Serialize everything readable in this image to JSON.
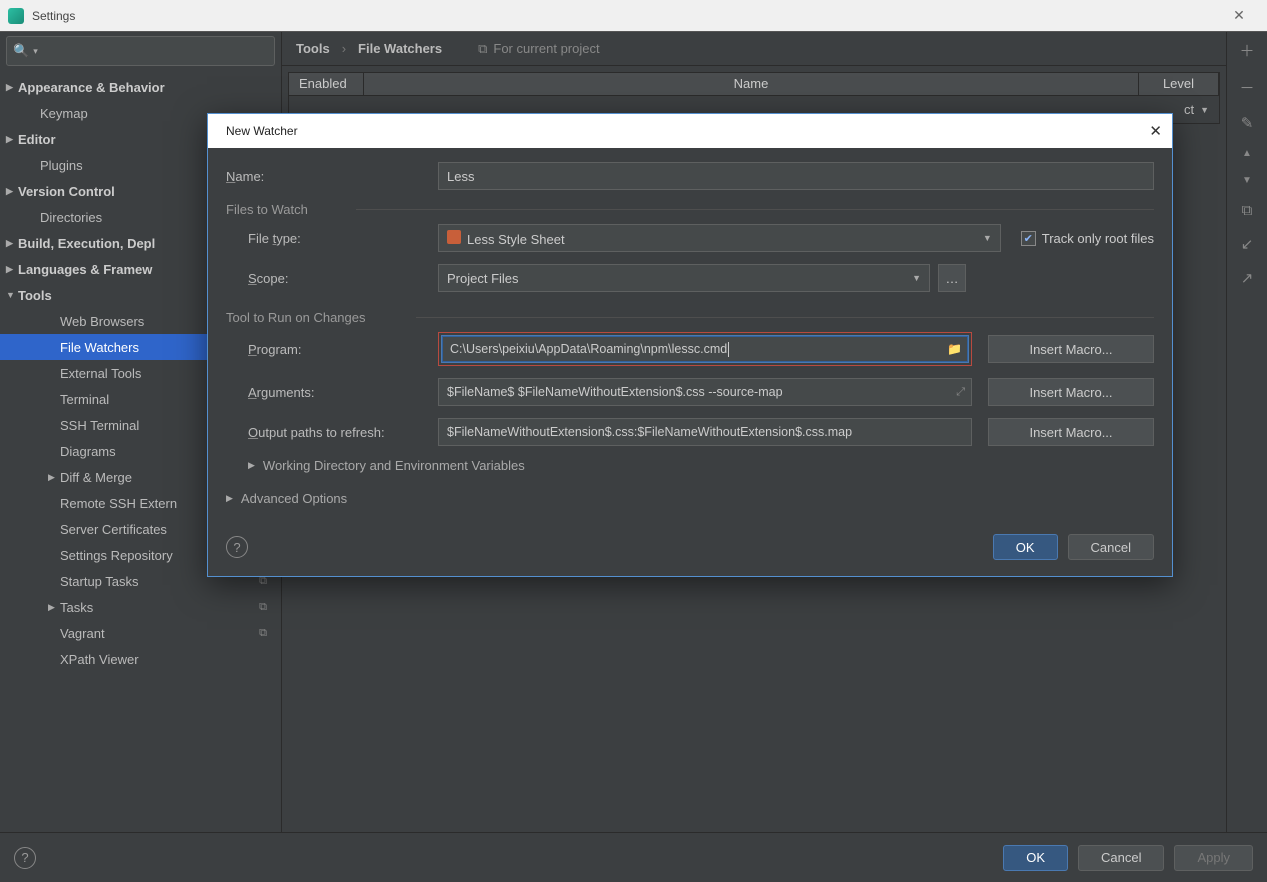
{
  "titlebar": {
    "title": "Settings"
  },
  "search_placeholder": "",
  "sidebar": [
    {
      "label": "Appearance & Behavior",
      "bold": true,
      "arrow": "▶"
    },
    {
      "label": "Keymap",
      "lvl": 1
    },
    {
      "label": "Editor",
      "bold": true,
      "arrow": "▶"
    },
    {
      "label": "Plugins",
      "lvl": 1
    },
    {
      "label": "Version Control",
      "bold": true,
      "arrow": "▶"
    },
    {
      "label": "Directories",
      "lvl": 1
    },
    {
      "label": "Build, Execution, Depl",
      "bold": true,
      "arrow": "▶",
      "trunc": true
    },
    {
      "label": "Languages & Framew",
      "bold": true,
      "arrow": "▶",
      "trunc": true
    },
    {
      "label": "Tools",
      "bold": true,
      "arrow": "▼"
    },
    {
      "label": "Web Browsers",
      "lvl": 2
    },
    {
      "label": "File Watchers",
      "lvl": 2,
      "selected": true
    },
    {
      "label": "External Tools",
      "lvl": 2
    },
    {
      "label": "Terminal",
      "lvl": 2
    },
    {
      "label": "SSH Terminal",
      "lvl": 2
    },
    {
      "label": "Diagrams",
      "lvl": 2
    },
    {
      "label": "Diff & Merge",
      "lvl": 2,
      "arrow": "▶"
    },
    {
      "label": "Remote SSH Extern",
      "lvl": 2,
      "trunc": true
    },
    {
      "label": "Server Certificates",
      "lvl": 2
    },
    {
      "label": "Settings Repository",
      "lvl": 2
    },
    {
      "label": "Startup Tasks",
      "lvl": 2,
      "copy": true
    },
    {
      "label": "Tasks",
      "lvl": 2,
      "arrow": "▶",
      "copy": true
    },
    {
      "label": "Vagrant",
      "lvl": 2,
      "copy": true
    },
    {
      "label": "XPath Viewer",
      "lvl": 2
    }
  ],
  "breadcrumb": {
    "a": "Tools",
    "b": "File Watchers",
    "proj": "For current project"
  },
  "table": {
    "h_enabled": "Enabled",
    "h_name": "Name",
    "h_level": "Level",
    "row_level": "ct"
  },
  "modal": {
    "title": "New Watcher",
    "name_label": "Name:",
    "name_under": "N",
    "name_value": "Less",
    "section_files": "Files to Watch",
    "filetype_label": "File type:",
    "filetype_under": "t",
    "filetype_value": "Less Style Sheet",
    "scope_label": "Scope:",
    "scope_under": "S",
    "scope_value": "Project Files",
    "track_label": "Track only root files",
    "section_tool": "Tool to Run on Changes",
    "program_label": "Program:",
    "program_under": "P",
    "program_value": "C:\\Users\\peixiu\\AppData\\Roaming\\npm\\lessc.cmd",
    "arguments_label": "Arguments:",
    "arguments_under": "A",
    "arguments_value": "$FileName$ $FileNameWithoutExtension$.css --source-map",
    "output_label": "Output paths to refresh:",
    "output_under": "O",
    "output_value": "$FileNameWithoutExtension$.css:$FileNameWithoutExtension$.css.map",
    "insert_macro": "Insert Macro...",
    "exp_working": "Working Directory and Environment Variables",
    "exp_adv": "Advanced Options",
    "ok": "OK",
    "cancel": "Cancel"
  },
  "footer": {
    "ok": "OK",
    "cancel": "Cancel",
    "apply": "Apply"
  }
}
